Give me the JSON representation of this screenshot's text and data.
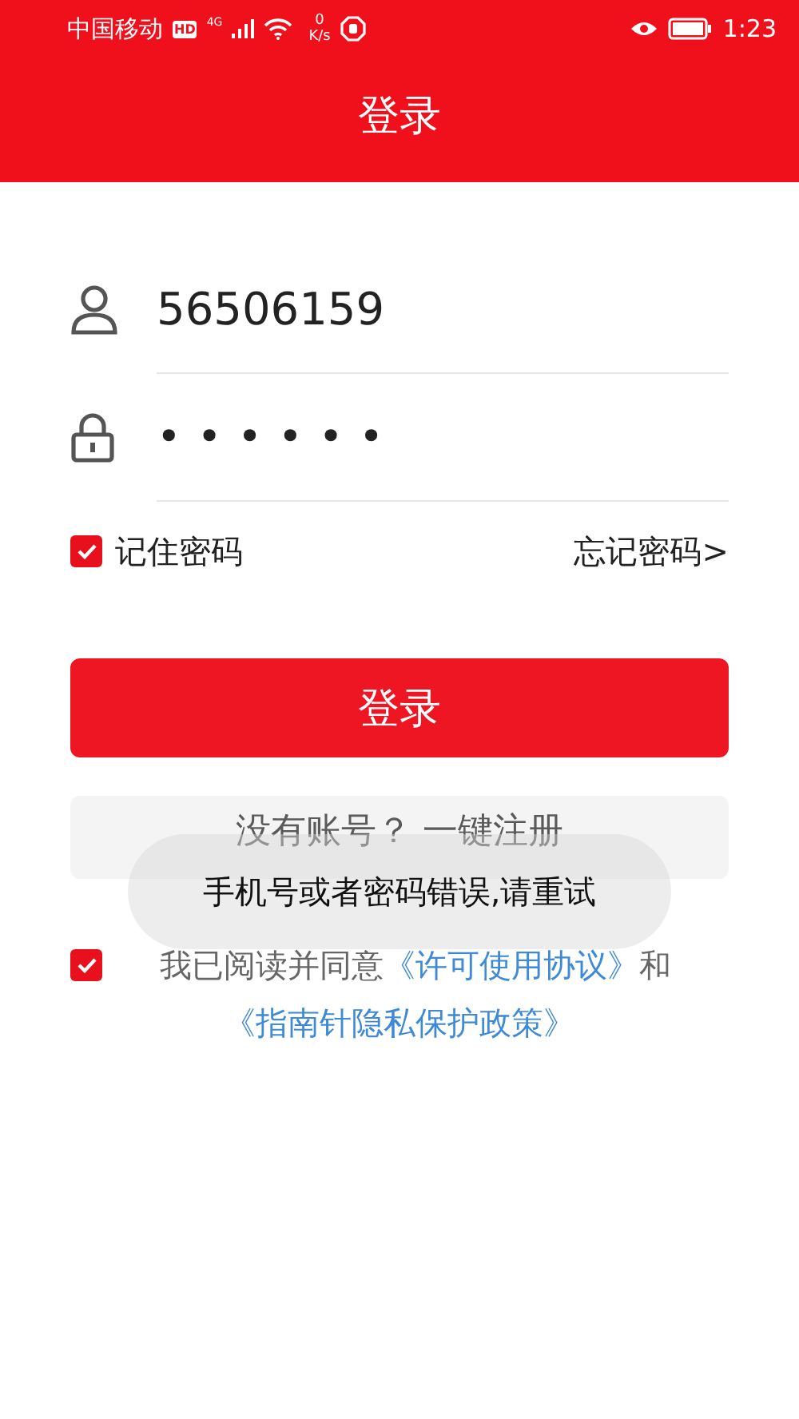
{
  "status_bar": {
    "carrier": "中国移动",
    "hd": "HD",
    "network": "4G",
    "speed_value": "0",
    "speed_unit": "K/s",
    "time": "1:23"
  },
  "header": {
    "title": "登录"
  },
  "form": {
    "username": {
      "value": "56506159"
    },
    "password": {
      "value": "••••••"
    },
    "remember": {
      "label": "记住密码",
      "checked": true
    },
    "forgot": "忘记密码>",
    "login_button": "登录",
    "register_button": "没有账号？ 一键注册"
  },
  "toast": "手机号或者密码错误,请重试",
  "agreement": {
    "checked": true,
    "prefix": "我已阅读并同意",
    "link1": "《许可使用协议》",
    "middle": "和",
    "link2": "《指南针隐私保护政策》"
  }
}
